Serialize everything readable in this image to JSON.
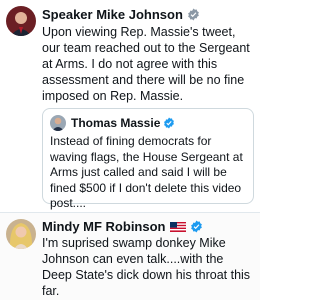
{
  "tweet_main": {
    "author": "Speaker Mike Johnson",
    "text": "Upon viewing Rep. Massie's tweet, our team reached out to the Sergeant at Arms. I do not agree with this assessment and there will be no fine imposed on Rep. Massie."
  },
  "quoted_tweet": {
    "author": "Thomas Massie",
    "text": "Instead of fining democrats for waving flags, the House Sergeant at Arms just called and said I will be fined $500 if I don't delete this video post...."
  },
  "tweet_reply": {
    "author": "Mindy MF Robinson",
    "text": "I'm suprised swamp donkey Mike Johnson can even talk....with the Deep State's dick down his throat this far."
  },
  "colors": {
    "verified_blue": "#1d9bf0",
    "text": "#0f1419",
    "border": "#cfd9de"
  },
  "icons": [
    "verified-badge-icon",
    "us-flag-icon"
  ]
}
